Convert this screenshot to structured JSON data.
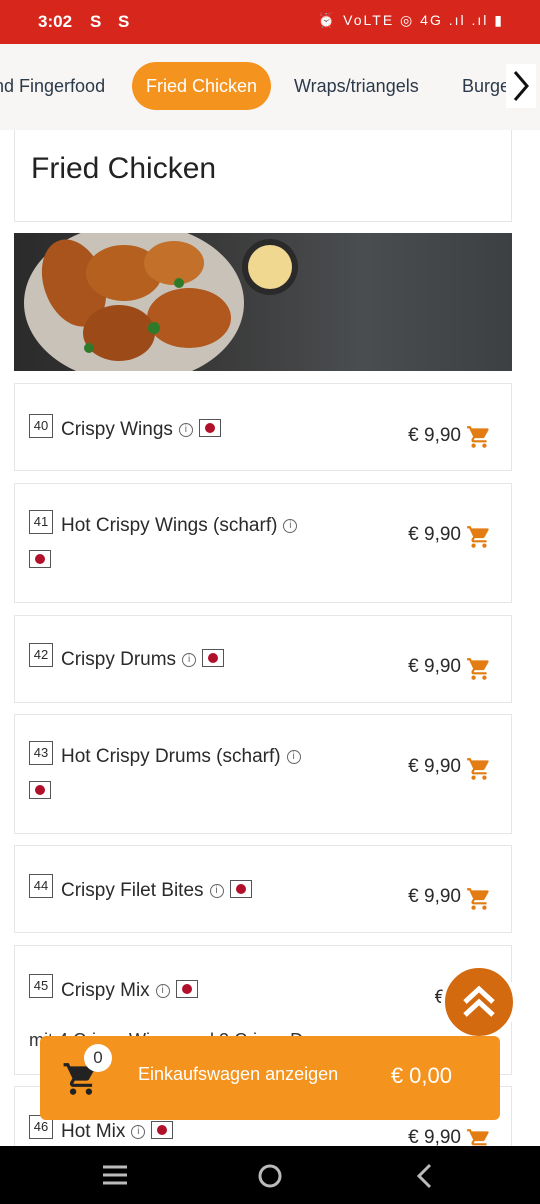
{
  "status": {
    "time": "3:02",
    "notif": "S S",
    "right": "⏰ VoLTE ◎ 4G .ıl .ıl ▮"
  },
  "categories": [
    "nd Fingerfood",
    "Fried Chicken",
    "Wraps/triangels",
    "Burge"
  ],
  "section": {
    "title": "Fried Chicken"
  },
  "products": [
    {
      "num": "40",
      "name": "Crispy Wings",
      "price": "€ 9,90"
    },
    {
      "num": "41",
      "name": "Hot Crispy Wings (scharf)",
      "price": "€ 9,90"
    },
    {
      "num": "42",
      "name": "Crispy Drums",
      "price": "€ 9,90"
    },
    {
      "num": "43",
      "name": "Hot Crispy Drums (scharf)",
      "price": "€ 9,90"
    },
    {
      "num": "44",
      "name": "Crispy Filet Bites",
      "price": "€ 9,90"
    },
    {
      "num": "45",
      "name": "Crispy Mix",
      "price": "€ 9",
      "desc": "mit 4 Crispy Wings und 2 Crispy Drums"
    },
    {
      "num": "46",
      "name": "Hot Mix",
      "price": "€ 9,90"
    }
  ],
  "cart": {
    "count": "0",
    "label": "Einkaufswagen anzeigen",
    "total": "€ 0,00"
  },
  "colors": {
    "accent": "#f5931f",
    "status": "#d7261c",
    "fab": "#d36a10"
  },
  "icons": {
    "cart": "cart-icon",
    "info": "info-icon",
    "flag": "flag-icon",
    "scroll_top": "double-chevron-up-icon"
  }
}
